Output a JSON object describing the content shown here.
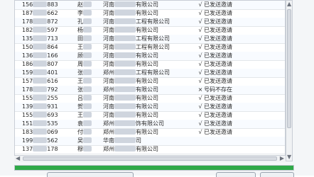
{
  "rows": [
    {
      "phone": "156",
      "phone_tail": "883",
      "name": "赵",
      "company": "河南",
      "company_tail": "有限公司",
      "mark": "√",
      "status": "已发送邀请"
    },
    {
      "phone": "187",
      "phone_tail": "662",
      "name": "李",
      "company": "河南",
      "company_tail": "有限公司",
      "mark": "√",
      "status": "已发送邀请"
    },
    {
      "phone": "178",
      "phone_tail": "872",
      "name": "孔",
      "company": "河南",
      "company_tail": "工程有限公司",
      "mark": "√",
      "status": "已发送邀请"
    },
    {
      "phone": "182",
      "phone_tail": "597",
      "name": "杨",
      "company": "河南",
      "company_tail": "有限公司",
      "mark": "√",
      "status": "已发送邀请"
    },
    {
      "phone": "135",
      "phone_tail": "713",
      "name": "田",
      "company": "河南",
      "company_tail": "工程有限公司",
      "mark": "√",
      "status": "已发送邀请"
    },
    {
      "phone": "150",
      "phone_tail": "864",
      "name": "王",
      "company": "河南",
      "company_tail": "工程有限公司",
      "mark": "√",
      "status": "已发送邀请"
    },
    {
      "phone": "136",
      "phone_tail": "166",
      "name": "顾",
      "company": "河南",
      "company_tail": "有限公司",
      "mark": "√",
      "status": "已发送邀请"
    },
    {
      "phone": "186",
      "phone_tail": "807",
      "name": "周",
      "company": "河南",
      "company_tail": "有限公司",
      "mark": "√",
      "status": "已发送邀请"
    },
    {
      "phone": "159",
      "phone_tail": "401",
      "name": "张",
      "company": "郑州",
      "company_tail": "工程有限公司",
      "mark": "√",
      "status": "已发送邀请"
    },
    {
      "phone": "157",
      "phone_tail": "616",
      "name": "王",
      "company": "河南",
      "company_tail": "有限公司",
      "mark": "√",
      "status": "已发送邀请"
    },
    {
      "phone": "178",
      "phone_tail": "792",
      "name": "张",
      "company": "郑州",
      "company_tail": "有限公司",
      "mark": "×",
      "status": "号码不存在"
    },
    {
      "phone": "155",
      "phone_tail": "255",
      "name": "吕",
      "company": "河南",
      "company_tail": "有限公司",
      "mark": "√",
      "status": "已发送邀请"
    },
    {
      "phone": "139",
      "phone_tail": "931",
      "name": "贺",
      "company": "河南",
      "company_tail": "有限公司",
      "mark": "√",
      "status": "已发送邀请"
    },
    {
      "phone": "155",
      "phone_tail": "693",
      "name": "王",
      "company": "河南",
      "company_tail": "有限公司",
      "mark": "√",
      "status": "已发送邀请"
    },
    {
      "phone": "151",
      "phone_tail": "535",
      "name": "袁",
      "company": "郑州",
      "company_tail": "饰有限公司",
      "mark": "√",
      "status": "已发送邀请"
    },
    {
      "phone": "183",
      "phone_tail": "069",
      "name": "付",
      "company": "郑州",
      "company_tail": "有限公司",
      "mark": "√",
      "status": "已发送邀请"
    },
    {
      "phone": "199",
      "phone_tail": "562",
      "name": "吴",
      "company": "华南",
      "company_tail": "司",
      "mark": "",
      "status": ""
    },
    {
      "phone": "137",
      "phone_tail": "178",
      "name": "穆",
      "company": "郑州",
      "company_tail": "有限公司",
      "mark": "",
      "status": ""
    }
  ],
  "progress": {
    "value": 1.0
  },
  "colors": {
    "progress_fill": "#2fa948",
    "grid_border": "#c9ced6"
  },
  "icons": {
    "scroll_up": "▲",
    "scroll_down": "▼",
    "scroll_left": "◀",
    "scroll_right": "▶"
  }
}
